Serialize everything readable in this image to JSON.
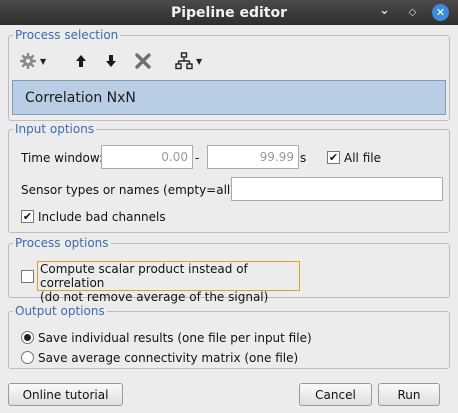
{
  "window": {
    "title": "Pipeline editor",
    "minimize_glyph": "⌄",
    "maximize_glyph": "◇",
    "close_glyph": "✕"
  },
  "process_selection": {
    "title": "Process selection",
    "toolbar": {
      "icons": [
        "gear-icon",
        "arrow-up-icon",
        "arrow-down-icon",
        "delete-icon",
        "pipeline-tree-icon"
      ]
    },
    "selected_process": "Correlation NxN"
  },
  "input_options": {
    "title": "Input options",
    "time_window_label": "Time window:",
    "time_start": "0.00",
    "time_sep": "-",
    "time_end": "99.99",
    "time_unit": "s",
    "all_file_label": "All file",
    "all_file_checked": true,
    "sensor_label": "Sensor types or names (empty=all):",
    "sensor_value": "",
    "include_bad_label": "Include bad channels",
    "include_bad_checked": true
  },
  "process_options": {
    "title": "Process options",
    "scalar_label_line1": "Compute scalar product instead of correlation",
    "scalar_label_line2": "(do not remove average of the signal)",
    "scalar_checked": false
  },
  "output_options": {
    "title": "Output options",
    "options": [
      {
        "label": "Save individual results (one file per input file)",
        "selected": true
      },
      {
        "label": "Save average connectivity matrix (one file)",
        "selected": false
      }
    ]
  },
  "buttons": {
    "tutorial": "Online tutorial",
    "cancel": "Cancel",
    "run": "Run"
  },
  "check_glyph": "✔"
}
